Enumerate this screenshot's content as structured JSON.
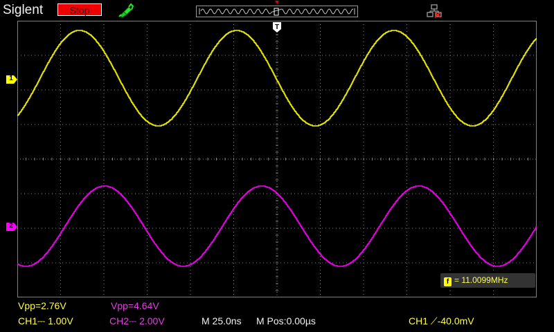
{
  "header": {
    "brand": "Siglent",
    "run_state": "Stop",
    "probe_icon": "probe-connected-icon",
    "network_icon": "network-disconnected-icon"
  },
  "colors": {
    "ch1": "#ffff00",
    "ch2": "#ff00ff",
    "grid": "#808080",
    "background": "#000000",
    "stop_button": "#f00000"
  },
  "channels": [
    {
      "id": "1",
      "marker": "1",
      "color": "#ffff00"
    },
    {
      "id": "2",
      "marker": "2",
      "color": "#ff00ff"
    }
  ],
  "trigger": {
    "marker": "T",
    "position_marker_icon": "trigger-position-icon"
  },
  "measurements": {
    "ch1_vpp": "Vpp=2.76V",
    "ch2_vpp": "Vpp=4.64V",
    "frequency_tag": "f",
    "frequency": "= 11.0099MHz"
  },
  "status_bar": {
    "ch1_scale": "CH1⎓ 1.00V",
    "ch2_scale": "CH2⎓ 2.00V",
    "timebase": "M 25.0ns",
    "mpos": "M Pos:0.00µs",
    "trigger_info": "CH1 ⟋-40.0mV"
  },
  "chart_data": {
    "type": "line",
    "series": [
      {
        "name": "CH1",
        "frequency_mhz": 11.0099,
        "vpp_v": 2.76,
        "volts_per_div": 1.0
      },
      {
        "name": "CH2",
        "frequency_mhz": 11.0099,
        "vpp_v": 4.64,
        "volts_per_div": 2.0
      }
    ],
    "time_per_div_ns": 25.0,
    "grid": true
  }
}
